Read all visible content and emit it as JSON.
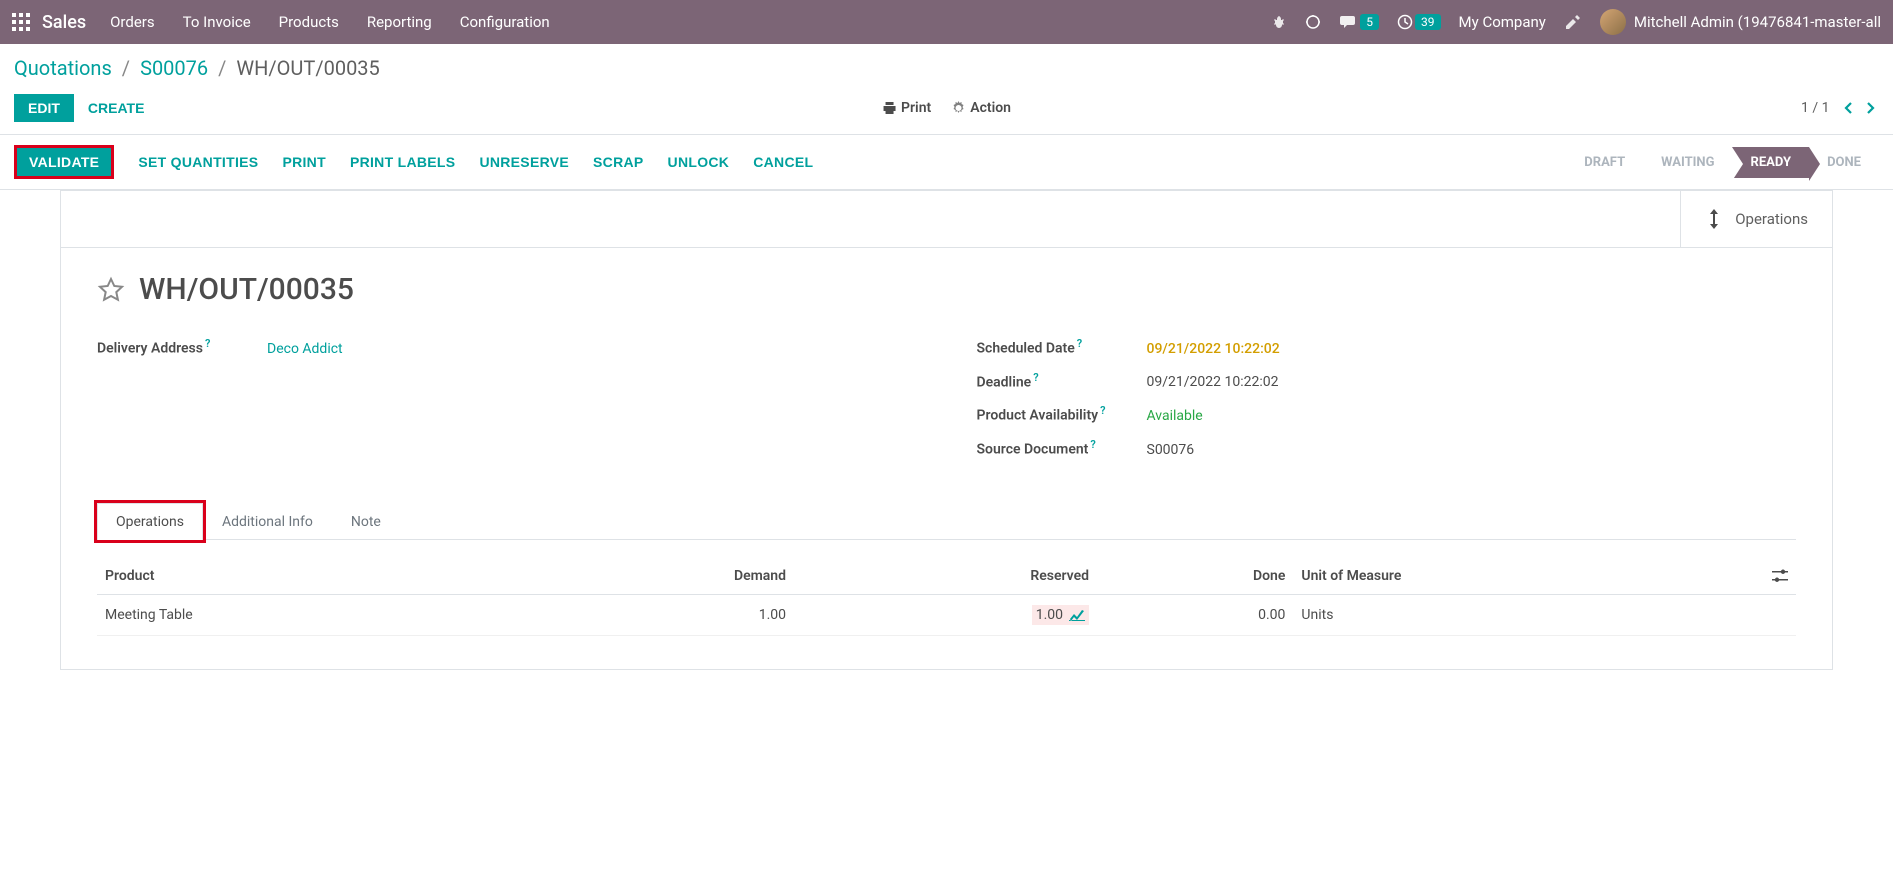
{
  "topnav": {
    "brand": "Sales",
    "menu": [
      "Orders",
      "To Invoice",
      "Products",
      "Reporting",
      "Configuration"
    ],
    "msg_badge": "5",
    "clock_badge": "39",
    "company": "My Company",
    "user": "Mitchell Admin (19476841-master-all"
  },
  "breadcrumb": {
    "level1": "Quotations",
    "level2": "S00076",
    "level3": "WH/OUT/00035"
  },
  "toolbar": {
    "edit": "EDIT",
    "create": "CREATE",
    "print": "Print",
    "action": "Action",
    "pager": "1 / 1"
  },
  "statusbar": {
    "actions": [
      "VALIDATE",
      "SET QUANTITIES",
      "PRINT",
      "PRINT LABELS",
      "UNRESERVE",
      "SCRAP",
      "UNLOCK",
      "CANCEL"
    ],
    "stages": [
      "DRAFT",
      "WAITING",
      "READY",
      "DONE"
    ]
  },
  "sheet": {
    "ops_button": "Operations",
    "title": "WH/OUT/00035",
    "fields_left": {
      "delivery_address_label": "Delivery Address",
      "delivery_address_value": "Deco Addict"
    },
    "fields_right": {
      "scheduled_label": "Scheduled Date",
      "scheduled_value": "09/21/2022 10:22:02",
      "deadline_label": "Deadline",
      "deadline_value": "09/21/2022 10:22:02",
      "avail_label": "Product Availability",
      "avail_value": "Available",
      "source_label": "Source Document",
      "source_value": "S00076"
    },
    "tabs": [
      "Operations",
      "Additional Info",
      "Note"
    ],
    "table": {
      "headers": {
        "product": "Product",
        "demand": "Demand",
        "reserved": "Reserved",
        "done": "Done",
        "uom": "Unit of Measure"
      },
      "row": {
        "product": "Meeting Table",
        "demand": "1.00",
        "reserved": "1.00",
        "done": "0.00",
        "uom": "Units"
      }
    }
  }
}
